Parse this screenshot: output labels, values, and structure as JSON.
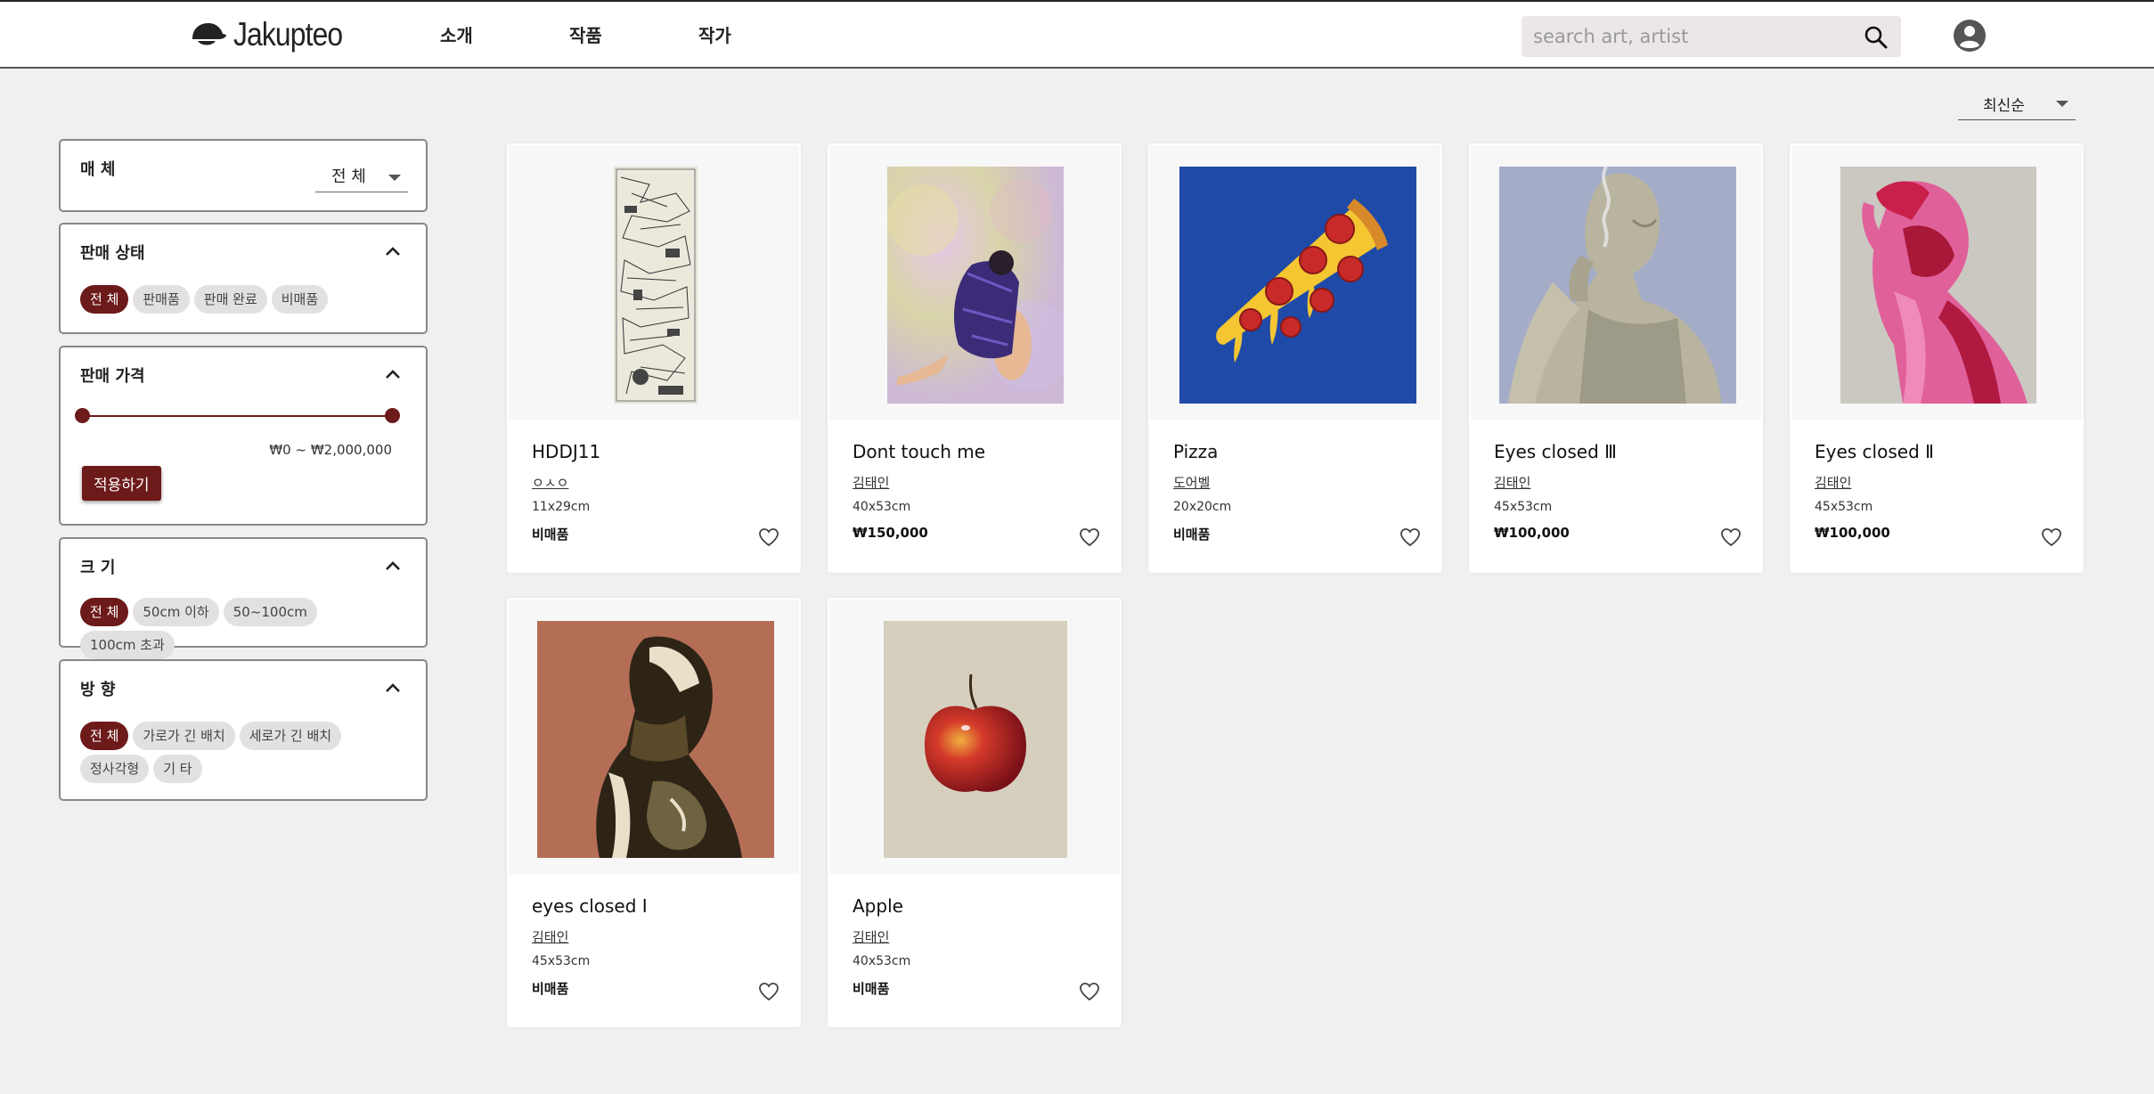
{
  "header": {
    "logo_text": "Jakupteo",
    "nav": [
      "소개",
      "작품",
      "작가"
    ],
    "search_placeholder": "search art, artist"
  },
  "sort": {
    "label": "최신순"
  },
  "filters": {
    "media": {
      "title": "매 체",
      "selected": "전 체"
    },
    "sale_status": {
      "title": "판매 상태",
      "options": [
        "전 체",
        "판매품",
        "판매 완료",
        "비매품"
      ],
      "active_index": 0
    },
    "price": {
      "title": "판매 가격",
      "range_text": "₩0 ~ ₩2,000,000",
      "min_fraction": 0,
      "max_fraction": 1,
      "apply_label": "적용하기"
    },
    "size": {
      "title": "크 기",
      "options": [
        "전 체",
        "50cm 이하",
        "50~100cm",
        "100cm 초과"
      ],
      "active_index": 0
    },
    "orientation": {
      "title": "방 향",
      "options": [
        "전 체",
        "가로가 긴 배치",
        "세로가 긴 배치",
        "정사각형",
        "기 타"
      ],
      "active_index": 0
    }
  },
  "artworks": [
    {
      "title": "HDDJ11",
      "artist": "ㅇㅅㅇ",
      "size": "11x29cm",
      "status": "비매품"
    },
    {
      "title": "Dont touch me",
      "artist": "김태인",
      "size": "40x53cm",
      "status": "₩150,000"
    },
    {
      "title": "Pizza",
      "artist": "도어벨",
      "size": "20x20cm",
      "status": "비매품"
    },
    {
      "title": "Eyes closed Ⅲ",
      "artist": "김태인",
      "size": "45x53cm",
      "status": "₩100,000"
    },
    {
      "title": "Eyes closed Ⅱ",
      "artist": "김태인",
      "size": "45x53cm",
      "status": "₩100,000"
    },
    {
      "title": "eyes closed Ⅰ",
      "artist": "김태인",
      "size": "45x53cm",
      "status": "비매품"
    },
    {
      "title": "Apple",
      "artist": "김태인",
      "size": "40x53cm",
      "status": "비매품"
    }
  ],
  "colors": {
    "accent": "#6d1a1a",
    "chip": "#e2e0e0",
    "background": "#f0f0f0"
  }
}
